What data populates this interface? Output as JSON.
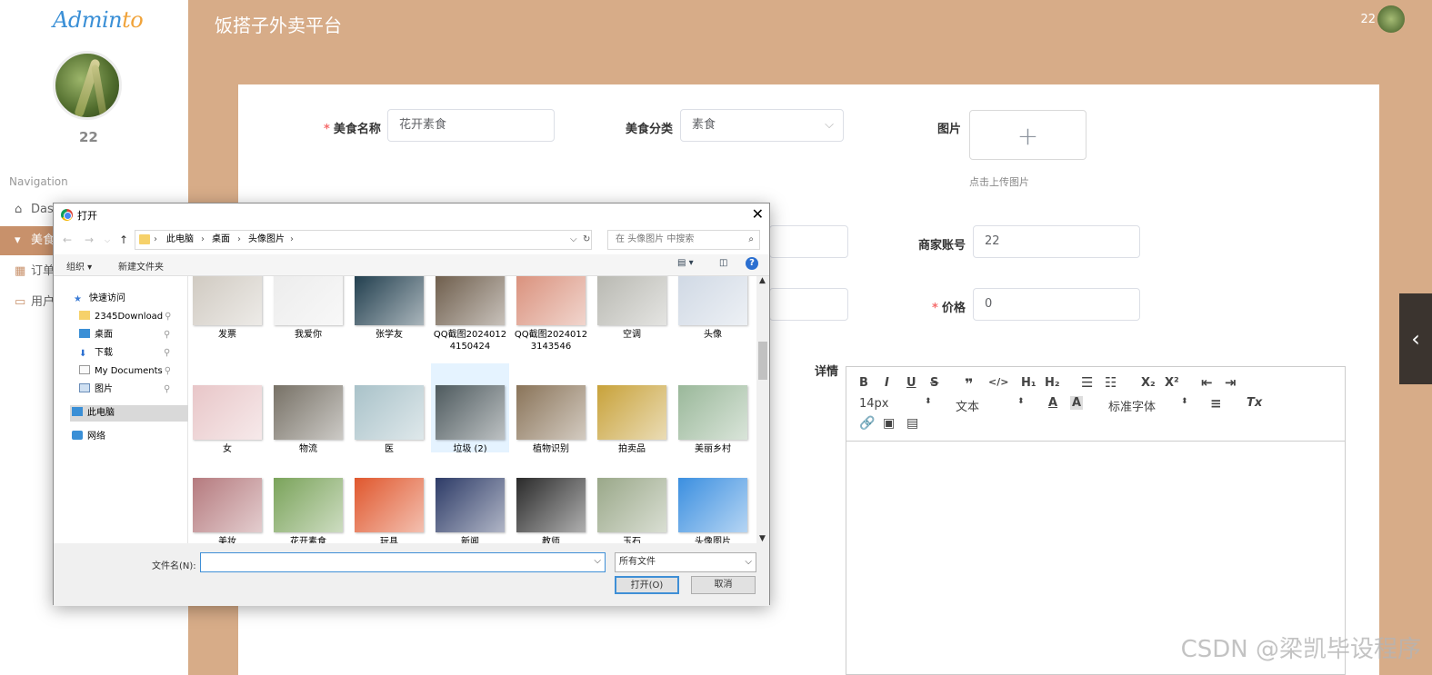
{
  "sidebar": {
    "logo_main": "Admin",
    "logo_accent": "to",
    "user_name": "22",
    "nav_heading": "Navigation",
    "items": [
      {
        "label": "Dash",
        "icon": "home-icon"
      },
      {
        "label": "美食",
        "icon": "thumb-icon"
      },
      {
        "label": "订单",
        "icon": "grid-icon"
      },
      {
        "label": "用户",
        "icon": "card-icon"
      }
    ]
  },
  "header": {
    "title": "饭搭子外卖平台",
    "user": "22"
  },
  "form": {
    "name_label": "美食名称",
    "name_value": "花开素食",
    "category_label": "美食分类",
    "category_value": "素食",
    "image_label": "图片",
    "upload_tip": "点击上传图片",
    "merchant_label": "商家账号",
    "merchant_value": "22",
    "price_label": "价格",
    "price_value": "0",
    "detail_label": "详情"
  },
  "editor": {
    "font_size": "14px",
    "text_type": "文本",
    "font_family": "标准字体"
  },
  "dialog": {
    "title": "打开",
    "path": [
      "此电脑",
      "桌面",
      "头像图片"
    ],
    "search_placeholder": "在 头像图片 中搜索",
    "organize": "组织 ▾",
    "new_folder": "新建文件夹",
    "tree": [
      {
        "label": "快速访问",
        "icon": "star-icon"
      },
      {
        "label": "2345Download",
        "icon": "folder-icon"
      },
      {
        "label": "桌面",
        "icon": "desktop-icon"
      },
      {
        "label": "下载",
        "icon": "download-icon"
      },
      {
        "label": "My Documents",
        "icon": "document-icon"
      },
      {
        "label": "图片",
        "icon": "picture-icon"
      },
      {
        "label": "此电脑",
        "icon": "computer-icon"
      },
      {
        "label": "网络",
        "icon": "network-icon"
      }
    ],
    "files": [
      {
        "name": "发票",
        "color": "#cfc9c0"
      },
      {
        "name": "我爱你",
        "color": "#ececec"
      },
      {
        "name": "张学友",
        "color": "#1c3a4a"
      },
      {
        "name": "QQ截图20240124150424",
        "color": "#6b5a48"
      },
      {
        "name": "QQ截图20240123143546",
        "color": "#d98f7a"
      },
      {
        "name": "空调",
        "color": "#b7b7b0"
      },
      {
        "name": "头像",
        "color": "#cfd8e4"
      },
      {
        "name": "女",
        "color": "#e8c6c8"
      },
      {
        "name": "物流",
        "color": "#777166"
      },
      {
        "name": "医",
        "color": "#a9c2c9"
      },
      {
        "name": "垃圾 (2)",
        "color": "#4e5a5e"
      },
      {
        "name": "植物识别",
        "color": "#8a7459"
      },
      {
        "name": "拍卖品",
        "color": "#c8a23a"
      },
      {
        "name": "美丽乡村",
        "color": "#9ab89a"
      },
      {
        "name": "美妆",
        "color": "#b57a7e"
      },
      {
        "name": "花开素食",
        "color": "#7aa35a"
      },
      {
        "name": "玩具",
        "color": "#e0572d"
      },
      {
        "name": "新闻",
        "color": "#2d3b67"
      },
      {
        "name": "教师",
        "color": "#2a2a2a"
      },
      {
        "name": "玉石",
        "color": "#9aa889"
      },
      {
        "name": "头像图片",
        "color": "#3b8fe0"
      }
    ],
    "filename_label": "文件名(N):",
    "filename_value": "",
    "filetype": "所有文件",
    "open_button": "打开(O)",
    "cancel_button": "取消"
  },
  "watermark": "CSDN @梁凯毕设程序"
}
